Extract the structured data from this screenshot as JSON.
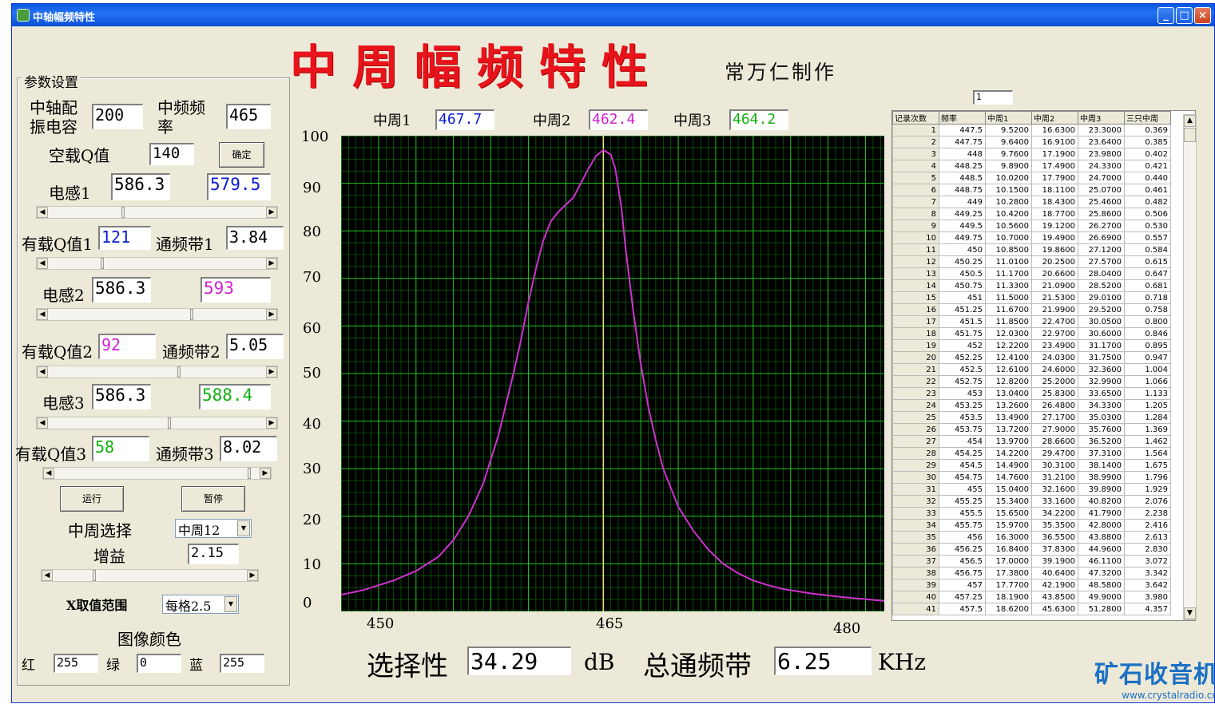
{
  "window": {
    "title": "中轴幅频特性"
  },
  "header": {
    "big_title": "中周幅频特性",
    "author": "常万仁制作"
  },
  "params": {
    "frame_label": "参数设置",
    "cap_label": "中轴配\n振电容",
    "cap_value": "200",
    "if_label": "中频频\n率",
    "if_value": "465",
    "q0_label": "空载Q值",
    "q0_value": "140",
    "confirm_button": "确定",
    "l1_label": "电感1",
    "l1_value": "586.3",
    "l1_computed": "579.5",
    "q1_label": "有载Q值1",
    "q1_value": "121",
    "bw1_label": "通频带1",
    "bw1_value": "3.84",
    "l2_label": "电感2",
    "l2_value": "586.3",
    "l2_computed": "593",
    "q2_label": "有载Q值2",
    "q2_value": "92",
    "bw2_label": "通频带2",
    "bw2_value": "5.05",
    "l3_label": "电感3",
    "l3_value": "586.3",
    "l3_computed": "588.4",
    "q3_label": "有载Q值3",
    "q3_value": "58",
    "bw3_label": "通频带3",
    "bw3_value": "8.02",
    "run_button": "运行",
    "pause_button": "暂停",
    "select_label": "中周选择",
    "select_value": "中周12",
    "gain_label": "增益",
    "gain_value": "2.15",
    "xrange_label": "X取值范围",
    "xrange_value": "每格2.5",
    "color_title": "图像颜色",
    "red_label": "红",
    "red_value": "255",
    "green_label": "绿",
    "green_value": "0",
    "blue_label": "蓝",
    "blue_value": "255"
  },
  "freqs": {
    "zz1_label": "中周1",
    "zz1_value": "467.7",
    "zz2_label": "中周2",
    "zz2_value": "462.4",
    "zz3_label": "中周3",
    "zz3_value": "464.2"
  },
  "bottom": {
    "sel_label": "选择性",
    "sel_value": "34.29",
    "sel_unit": "dB",
    "bw_label": "总通频带",
    "bw_value": "6.25",
    "bw_unit": "KHz"
  },
  "colors": {
    "zz1": "#0a1ad0",
    "zz2": "#d020d0",
    "zz3": "#10b010",
    "title": "#e8131b",
    "curve": "#d030d0"
  },
  "chart_data": {
    "type": "line",
    "xticks": [
      "450",
      "465",
      "480"
    ],
    "yticks": [
      "100",
      "90",
      "80",
      "70",
      "60",
      "50",
      "40",
      "30",
      "20",
      "10",
      "0"
    ],
    "xlim": [
      447.5,
      483.75
    ],
    "ylim": [
      0,
      100
    ],
    "grid": true,
    "series": [
      {
        "x": [
          447.5,
          449,
          451,
          452.5,
          454,
          455,
          456,
          457,
          458,
          459,
          459.5,
          460,
          460.5,
          461,
          461.5,
          462,
          462.5,
          463,
          463.5,
          464,
          464.5,
          465,
          465.5,
          465.8,
          466.2,
          466.5,
          467,
          467.5,
          468,
          468.5,
          469,
          470,
          471,
          472,
          473,
          474,
          475,
          476,
          477,
          479,
          481,
          483.75
        ],
        "y": [
          3.5,
          4.5,
          6.5,
          8.5,
          11.5,
          15,
          20,
          27,
          37,
          50,
          57,
          65,
          72,
          78,
          82,
          84,
          85.5,
          87,
          90,
          93,
          95.7,
          97,
          96,
          93,
          85,
          76,
          63,
          52,
          43,
          36,
          30,
          22,
          17,
          13,
          10,
          8,
          6.5,
          5.5,
          4.7,
          3.7,
          3,
          2.2
        ]
      }
    ]
  },
  "table": {
    "input_value": "1",
    "headers": [
      "记录次数",
      "频率",
      "中周1",
      "中周2",
      "中周3",
      "三只中周"
    ],
    "rows": [
      [
        "1",
        "447.5",
        "9.5200",
        "16.6300",
        "23.3000",
        "0.369"
      ],
      [
        "2",
        "447.75",
        "9.6400",
        "16.9100",
        "23.6400",
        "0.385"
      ],
      [
        "3",
        "448",
        "9.7600",
        "17.1900",
        "23.9800",
        "0.402"
      ],
      [
        "4",
        "448.25",
        "9.8900",
        "17.4900",
        "24.3300",
        "0.421"
      ],
      [
        "5",
        "448.5",
        "10.0200",
        "17.7900",
        "24.7000",
        "0.440"
      ],
      [
        "6",
        "448.75",
        "10.1500",
        "18.1100",
        "25.0700",
        "0.461"
      ],
      [
        "7",
        "449",
        "10.2800",
        "18.4300",
        "25.4600",
        "0.482"
      ],
      [
        "8",
        "449.25",
        "10.4200",
        "18.7700",
        "25.8600",
        "0.506"
      ],
      [
        "9",
        "449.5",
        "10.5600",
        "19.1200",
        "26.2700",
        "0.530"
      ],
      [
        "10",
        "449.75",
        "10.7000",
        "19.4900",
        "26.6900",
        "0.557"
      ],
      [
        "11",
        "450",
        "10.8500",
        "19.8600",
        "27.1200",
        "0.584"
      ],
      [
        "12",
        "450.25",
        "11.0100",
        "20.2500",
        "27.5700",
        "0.615"
      ],
      [
        "13",
        "450.5",
        "11.1700",
        "20.6600",
        "28.0400",
        "0.647"
      ],
      [
        "14",
        "450.75",
        "11.3300",
        "21.0900",
        "28.5200",
        "0.681"
      ],
      [
        "15",
        "451",
        "11.5000",
        "21.5300",
        "29.0100",
        "0.718"
      ],
      [
        "16",
        "451.25",
        "11.6700",
        "21.9900",
        "29.5200",
        "0.758"
      ],
      [
        "17",
        "451.5",
        "11.8500",
        "22.4700",
        "30.0500",
        "0.800"
      ],
      [
        "18",
        "451.75",
        "12.0300",
        "22.9700",
        "30.6000",
        "0.846"
      ],
      [
        "19",
        "452",
        "12.2200",
        "23.4900",
        "31.1700",
        "0.895"
      ],
      [
        "20",
        "452.25",
        "12.4100",
        "24.0300",
        "31.7500",
        "0.947"
      ],
      [
        "21",
        "452.5",
        "12.6100",
        "24.6000",
        "32.3600",
        "1.004"
      ],
      [
        "22",
        "452.75",
        "12.8200",
        "25.2000",
        "32.9900",
        "1.066"
      ],
      [
        "23",
        "453",
        "13.0400",
        "25.8300",
        "33.6500",
        "1.133"
      ],
      [
        "24",
        "453.25",
        "13.2600",
        "26.4800",
        "34.3300",
        "1.205"
      ],
      [
        "25",
        "453.5",
        "13.4900",
        "27.1700",
        "35.0300",
        "1.284"
      ],
      [
        "26",
        "453.75",
        "13.7200",
        "27.9000",
        "35.7600",
        "1.369"
      ],
      [
        "27",
        "454",
        "13.9700",
        "28.6600",
        "36.5200",
        "1.462"
      ],
      [
        "28",
        "454.25",
        "14.2200",
        "29.4700",
        "37.3100",
        "1.564"
      ],
      [
        "29",
        "454.5",
        "14.4900",
        "30.3100",
        "38.1400",
        "1.675"
      ],
      [
        "30",
        "454.75",
        "14.7600",
        "31.2100",
        "38.9900",
        "1.796"
      ],
      [
        "31",
        "455",
        "15.0400",
        "32.1600",
        "39.8900",
        "1.929"
      ],
      [
        "32",
        "455.25",
        "15.3400",
        "33.1600",
        "40.8200",
        "2.076"
      ],
      [
        "33",
        "455.5",
        "15.6500",
        "34.2200",
        "41.7900",
        "2.238"
      ],
      [
        "34",
        "455.75",
        "15.9700",
        "35.3500",
        "42.8000",
        "2.416"
      ],
      [
        "35",
        "456",
        "16.3000",
        "36.5500",
        "43.8800",
        "2.613"
      ],
      [
        "36",
        "456.25",
        "16.8400",
        "37.8300",
        "44.9600",
        "2.830"
      ],
      [
        "37",
        "456.5",
        "17.0000",
        "39.1900",
        "46.1100",
        "3.072"
      ],
      [
        "38",
        "456.75",
        "17.3800",
        "40.6400",
        "47.3200",
        "3.342"
      ],
      [
        "39",
        "457",
        "17.7700",
        "42.1900",
        "48.5800",
        "3.642"
      ],
      [
        "40",
        "457.25",
        "18.1900",
        "43.8500",
        "49.9000",
        "3.980"
      ],
      [
        "41",
        "457.5",
        "18.6200",
        "45.6300",
        "51.2800",
        "4.357"
      ]
    ]
  },
  "logo": {
    "name": "矿石收音机",
    "url": "www.crystalradio.cn"
  }
}
